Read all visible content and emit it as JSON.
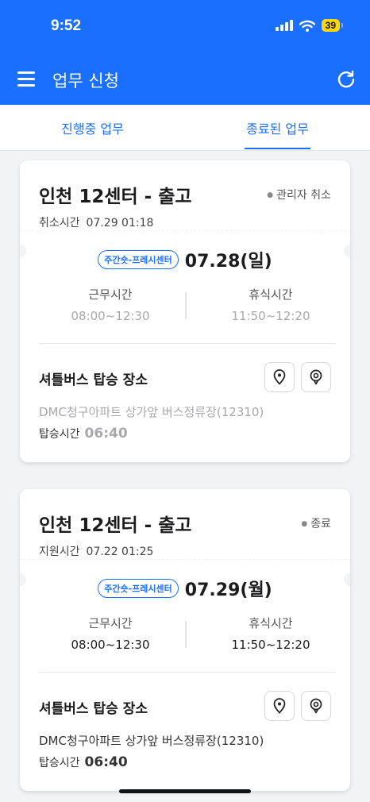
{
  "status_bar": {
    "time": "9:52",
    "battery": "39"
  },
  "app_bar": {
    "title": "업무 신청",
    "menu_icon": "hamburger-menu-icon",
    "refresh_icon": "refresh-icon"
  },
  "tabs": [
    {
      "label": "진행중 업무",
      "active": false
    },
    {
      "label": "종료된 업무",
      "active": true
    }
  ],
  "cards": [
    {
      "title": "인천 12센터 - 출고",
      "status": "관리자 취소",
      "time_label": "취소시간",
      "time_value": "07.29 01:18",
      "center_badge": "주간숏-프레시센터",
      "date": "07.28(일)",
      "work_label": "근무시간",
      "work_value": "08:00~12:30",
      "break_label": "휴식시간",
      "break_value": "11:50~12:20",
      "shuttle_title": "셔틀버스 탑승 장소",
      "address": "DMC청구아파트 상가앞 버스정류장(12310)",
      "boarding_label": "탑승시간",
      "boarding_value": "06:40"
    },
    {
      "title": "인천 12센터 - 출고",
      "status": "종료",
      "time_label": "지원시간",
      "time_value": "07.22 01:25",
      "center_badge": "주간숏-프레시센터",
      "date": "07.29(월)",
      "work_label": "근무시간",
      "work_value": "08:00~12:30",
      "break_label": "휴식시간",
      "break_value": "11:50~12:20",
      "shuttle_title": "셔틀버스 탑승 장소",
      "address": "DMC청구아파트 상가앞 버스정류장(12310)",
      "boarding_label": "탑승시간",
      "boarding_value": "06:40"
    }
  ],
  "colors": {
    "primary": "#1a6fff",
    "muted": "#a8a8ad"
  }
}
